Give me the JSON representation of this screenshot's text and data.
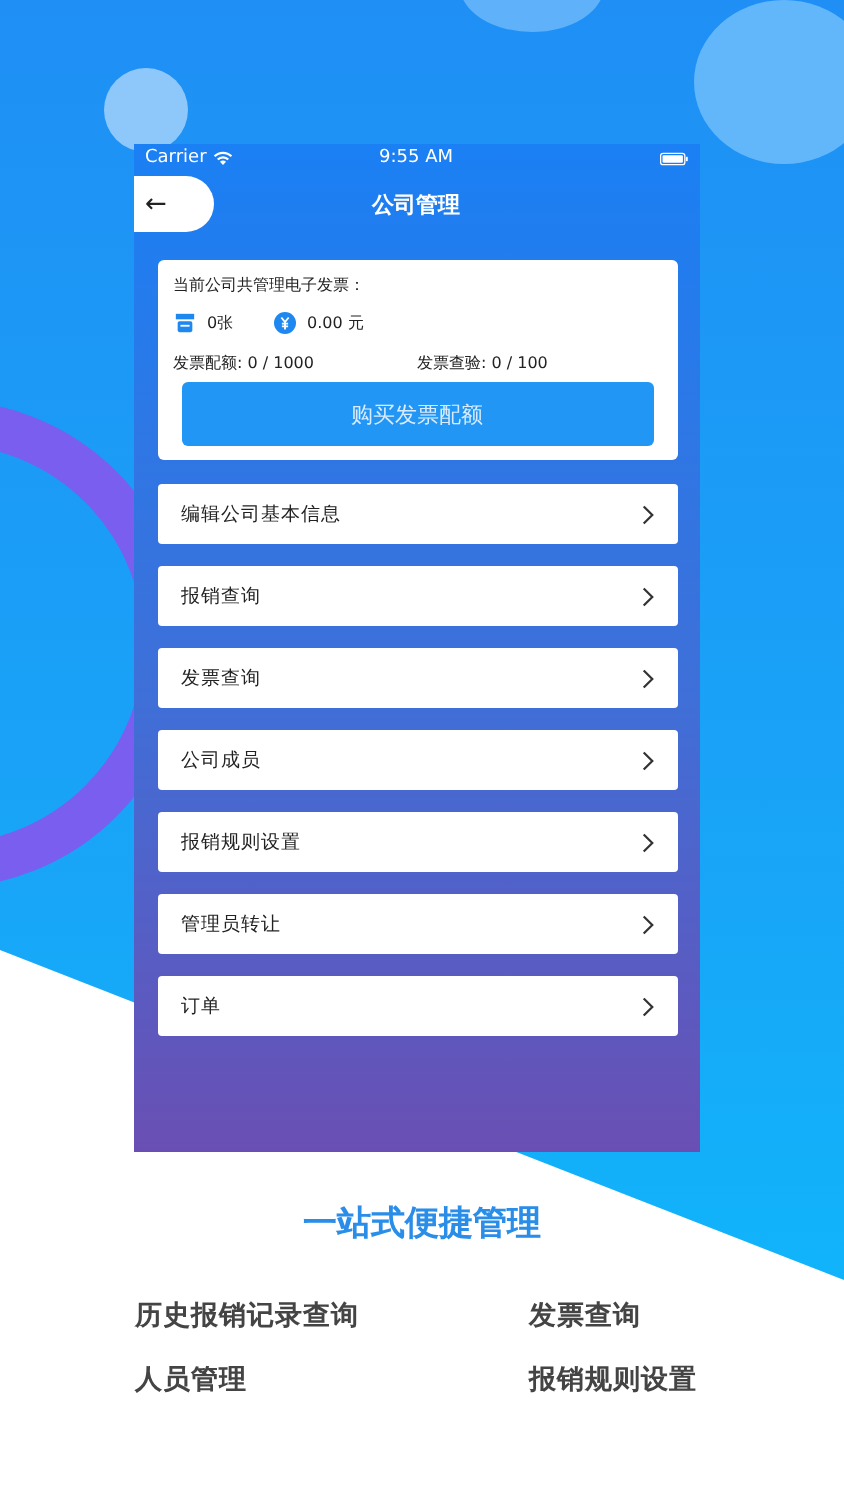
{
  "status_bar": {
    "carrier": "Carrier",
    "time": "9:55 AM"
  },
  "nav": {
    "back": "←",
    "title": "公司管理"
  },
  "summary": {
    "heading": "当前公司共管理电子发票：",
    "count": "0张",
    "amount": "0.00 元",
    "quota": "发票配额: 0 / 1000",
    "checks": "发票查验: 0 / 100",
    "button": "购买发票配额"
  },
  "menu_items": [
    {
      "label": "编辑公司基本信息"
    },
    {
      "label": "报销查询"
    },
    {
      "label": "发票查询"
    },
    {
      "label": "公司成员"
    },
    {
      "label": "报销规则设置"
    },
    {
      "label": "管理员转让"
    },
    {
      "label": "订单"
    }
  ],
  "headline": "一站式便捷管理",
  "features": [
    "历史报销记录查询",
    "发票查询",
    "人员管理",
    "报销规则设置"
  ]
}
